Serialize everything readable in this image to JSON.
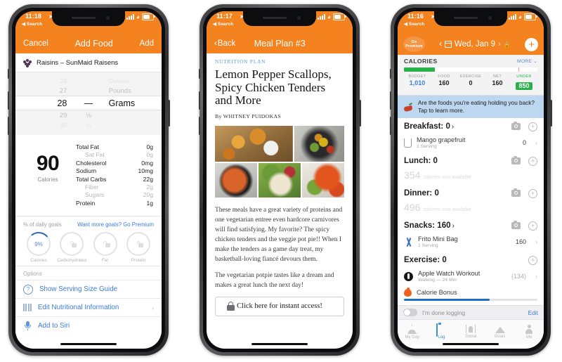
{
  "phones": {
    "add_food": {
      "status": {
        "time": "11:18",
        "loc_arrow": "➤",
        "back_label": "◀ Search"
      },
      "nav": {
        "left": "Cancel",
        "title": "Add Food",
        "right": "Add"
      },
      "food": {
        "name": "Raisins – SunMaid Raisens",
        "icon": "grapes-icon"
      },
      "picker": {
        "amount_above_far": "26",
        "amount_above": "27",
        "amount_selected": "28",
        "amount_below": "29",
        "amount_below_far": "30",
        "fraction_selected": "—",
        "fraction_below": "⅛",
        "fraction_below_far": "¼",
        "unit_above_far": "Ounces",
        "unit_above": "Pounds",
        "unit_selected": "Grams"
      },
      "calories": {
        "value": "90",
        "label": "Calories"
      },
      "facts": [
        {
          "label": "Total Fat",
          "value": "0g",
          "sub": false
        },
        {
          "label": "Sat Fat",
          "value": "0g",
          "sub": true
        },
        {
          "label": "Cholesterol",
          "value": "0mg",
          "sub": false
        },
        {
          "label": "Sodium",
          "value": "10mg",
          "sub": false
        },
        {
          "label": "Total Carbs",
          "value": "22g",
          "sub": false
        },
        {
          "label": "Fiber",
          "value": "2g",
          "sub": true
        },
        {
          "label": "Sugars",
          "value": "20g",
          "sub": true
        },
        {
          "label": "Protein",
          "value": "1g",
          "sub": false
        }
      ],
      "goals": {
        "title": "% of daily goals",
        "premium_link": "Want more goals? Go Premium",
        "rings": [
          {
            "label": "Calories",
            "value": "9%",
            "locked": false
          },
          {
            "label": "Carbohydrates",
            "value": "",
            "locked": true
          },
          {
            "label": "Fat",
            "value": "",
            "locked": true
          },
          {
            "label": "Protein",
            "value": "",
            "locked": true
          }
        ]
      },
      "options_header": "Options",
      "options": [
        {
          "label": "Show Serving Size Guide",
          "icon": "question-circle-icon",
          "chevron": ""
        },
        {
          "label": "Edit Nutritional Information",
          "icon": "barcode-icon",
          "chevron": "›"
        },
        {
          "label": "Add to Siri",
          "icon": "microphone-icon",
          "chevron": ""
        }
      ]
    },
    "meal_plan": {
      "status": {
        "time": "11:17",
        "loc_arrow": "➤",
        "back_label": "◀ Search"
      },
      "nav": {
        "left": "Back",
        "title": "Meal Plan #3"
      },
      "kicker": "NUTRITION PLAN",
      "headline": "Lemon Pepper Scallops, Spicy Chicken Tenders and More",
      "byline": "By WHITNEY PUIDOKAS",
      "photos": [
        {
          "name": "pot-pies-photo"
        },
        {
          "name": "stir-fry-photo"
        },
        {
          "name": "soup-photo"
        },
        {
          "name": "scallop-salad-photo"
        },
        {
          "name": "fried-shrimp-photo"
        }
      ],
      "paragraph_1": "These meals have a great variety of proteins and one vegetarian entree even hardcore carnivores will find satisfying. My favorite? The spicy chicken tenders and the veggie pot pie!! When I make the tenders as a game day treat, my basketball-loving fiancé devours them.",
      "paragraph_2": "The vegetarian potpie tastes like a dream and makes a great lunch the next day!",
      "cta": {
        "label": "Click here for instant access!",
        "icon": "padlock-icon"
      }
    },
    "log": {
      "status": {
        "time": "11:16",
        "loc_arrow": "➤",
        "back_label": "◀ Search"
      },
      "nav": {
        "premium_line1": "Go",
        "premium_line2": "Premium",
        "prev": "‹",
        "date": "Wed, Jan 9",
        "next": "›",
        "add": "+"
      },
      "calories": {
        "title": "CALORIES",
        "more": "MORE",
        "bar_fill_pct": 23,
        "stats": [
          {
            "key": "BUDGET",
            "value": "1,010"
          },
          {
            "key": "FOOD",
            "value": "160"
          },
          {
            "key": "EXERCISE",
            "value": "0"
          },
          {
            "key": "NET",
            "value": "160"
          },
          {
            "key": "UNDER",
            "value": "850"
          }
        ]
      },
      "banner": {
        "line1": "Are the foods you're eating holding you back?",
        "line2": "Tap to learn more.",
        "icon": "chili-pepper-icon"
      },
      "sections": [
        {
          "title": "Breakfast: 0",
          "chevron": "›",
          "has_camera": true,
          "entries": [
            {
              "name": "Mango grapefruit",
              "sub": "1 Serving",
              "value": "0",
              "icon": "glass-icon",
              "dim": false
            }
          ],
          "available": null
        },
        {
          "title": "Lunch: 0",
          "chevron": "",
          "has_camera": true,
          "entries": [],
          "available": {
            "num": "354",
            "label": "calories now available"
          }
        },
        {
          "title": "Dinner: 0",
          "chevron": "",
          "has_camera": true,
          "entries": [],
          "available": {
            "num": "496",
            "label": "calories now available"
          }
        },
        {
          "title": "Snacks: 160",
          "chevron": "›",
          "has_camera": true,
          "entries": [
            {
              "name": "Frito Mini Bag",
              "sub": "1 Serving",
              "value": "160",
              "icon": "fork-knife-icon",
              "dim": false
            }
          ],
          "available": null
        },
        {
          "title": "Exercise: 0",
          "chevron": "",
          "has_camera": false,
          "entries": [
            {
              "name": "Apple Watch Workout",
              "sub": "Walking — 24 Min",
              "value": "(134)",
              "icon": "apple-watch-icon",
              "dim": true
            },
            {
              "name": "Calorie Bonus",
              "sub": "",
              "value": "",
              "icon": "flame-icon",
              "dim": false
            }
          ],
          "available": null
        }
      ],
      "done": {
        "label": "I'm done logging",
        "edit": "Edit",
        "toggle_on": false
      },
      "tabs": [
        {
          "label": "My Day",
          "icon": "sunrise-icon",
          "active": false
        },
        {
          "label": "Log",
          "icon": "clipboard-icon",
          "active": true
        },
        {
          "label": "Social",
          "icon": "social-icon",
          "active": false
        },
        {
          "label": "Goals",
          "icon": "mountain-icon",
          "active": false
        },
        {
          "label": "Me",
          "icon": "person-icon",
          "active": false
        }
      ]
    }
  },
  "colors": {
    "brand_orange": "#F4821F",
    "link_blue": "#3b7dd8",
    "green": "#2bb14c",
    "banner_blue": "#bcd7ef"
  }
}
